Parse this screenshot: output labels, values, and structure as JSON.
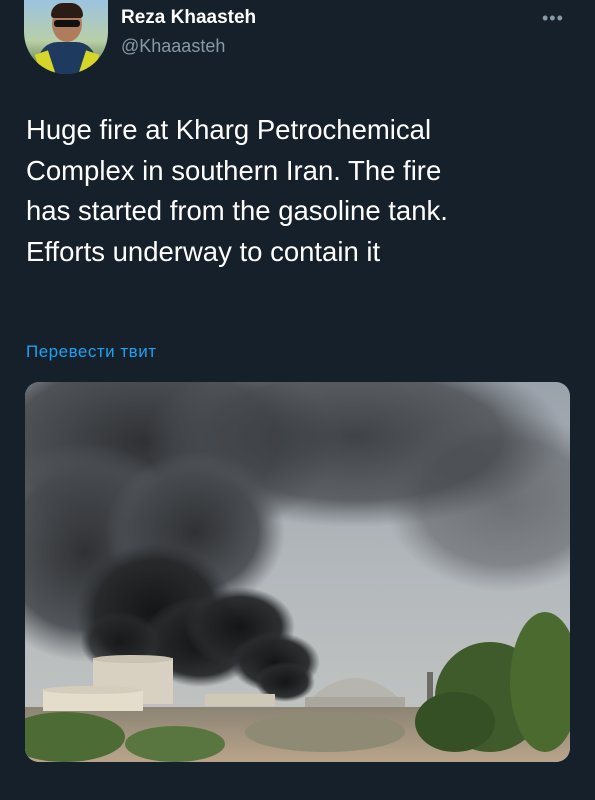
{
  "tweet": {
    "author_name": "Reza Khaasteh",
    "author_handle": "@Khaaasteh",
    "more_icon": "more-horizontal-icon",
    "text_lines": [
      "Huge fire at Kharg Petrochemical",
      "Complex in southern Iran. The fire",
      "has started from the gasoline tank.",
      "Efforts underway to contain it"
    ],
    "translate_label": "Перевести твит",
    "media_kind": "photo"
  },
  "colors": {
    "background": "#15202b",
    "text": "#ffffff",
    "secondary": "#8899a6",
    "link": "#1da1f2"
  }
}
